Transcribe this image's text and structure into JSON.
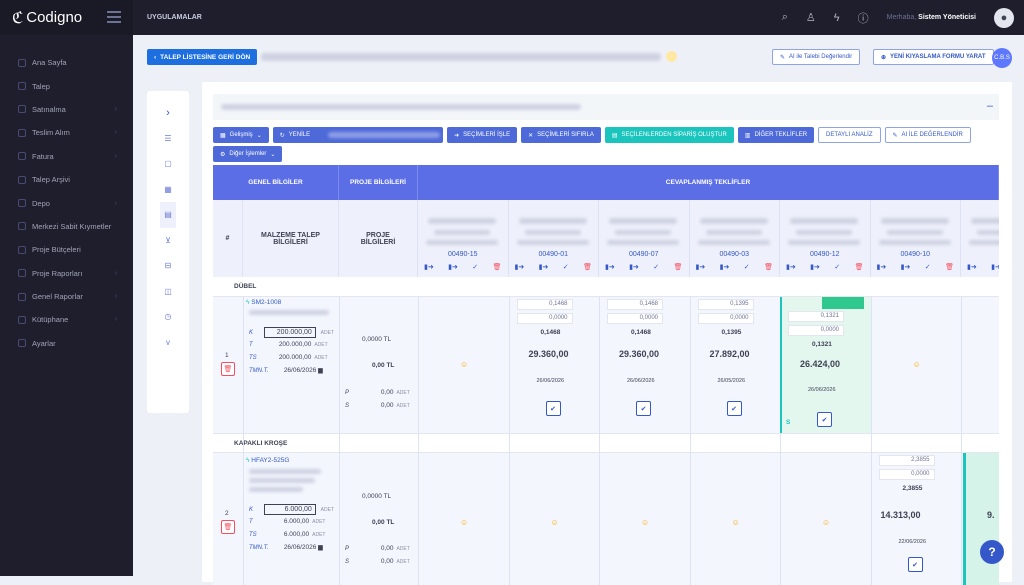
{
  "app": {
    "logo": "Codigno",
    "apps_label": "UYGULAMALAR"
  },
  "user": {
    "greeting": "Merhaba,",
    "name": "Sistem Yöneticisi"
  },
  "sidebar": {
    "items": [
      {
        "label": "Ana Sayfa",
        "arrow": false
      },
      {
        "label": "Talep",
        "arrow": false
      },
      {
        "label": "Satınalma",
        "arrow": true
      },
      {
        "label": "Teslim Alım",
        "arrow": true
      },
      {
        "label": "Fatura",
        "arrow": true
      },
      {
        "label": "Talep Arşivi",
        "arrow": false
      },
      {
        "label": "Depo",
        "arrow": true
      },
      {
        "label": "Merkezi Sabit Kıymetler",
        "arrow": false
      },
      {
        "label": "Proje Bütçeleri",
        "arrow": false
      },
      {
        "label": "Proje Raporları",
        "arrow": true
      },
      {
        "label": "Genel Raporlar",
        "arrow": true
      },
      {
        "label": "Kütüphane",
        "arrow": true
      },
      {
        "label": "Ayarlar",
        "arrow": false
      }
    ]
  },
  "header": {
    "back_label": "TALEP LİSTESİNE GERİ DÖN",
    "ai_button": "AI ile Talebi Değerlendir",
    "new_form_button": "YENİ KIYASLAMA FORMU YARAT",
    "avatar_text": "C.B.S"
  },
  "toolbar": {
    "advanced": "Gelişmiş",
    "refresh": "YENİLE",
    "process": "SEÇİMLERİ İŞLE",
    "reset": "SEÇİMLERİ SIFIRLA",
    "create_order": "SEÇİLENLERDEN SİPARİŞ OLUŞTUR",
    "other_offers": "DİĞER TEKLİFLER",
    "detail": "DETAYLI ANALİZ",
    "ai_eval": "AI İLE DEĞERLENDİR",
    "other_ops": "Diğer İşlemler"
  },
  "grid": {
    "headers": {
      "general": "GENEL BİLGİLER",
      "project": "PROJE BİLGİLERİ",
      "offers": "CEVAPLANMIŞ TEKLİFLER"
    },
    "sub": {
      "hash": "#",
      "material": "MALZEME TALEP BİLGİLERİ",
      "project": "PROJE BİLGİLERİ"
    },
    "offer_codes": [
      "00490-15",
      "00490-01",
      "00490-07",
      "00490-03",
      "00490-12",
      "00490-10",
      "0"
    ],
    "groups": [
      "DÜBEL",
      "KAPAKLI KROŞE"
    ],
    "rows": [
      {
        "no": "1",
        "code": "SM2-1008",
        "k": "200.000,00",
        "t": "200.000,00",
        "ts": "200.000,00",
        "tmn": "26/06/2026",
        "proj_total": "0,0000 TL",
        "proj_val": "0,00 TL",
        "p": "0,00",
        "s": "0,00"
      },
      {
        "no": "2",
        "code": "HFAY2-525G",
        "k": "6.000,00",
        "t": "6.000,00",
        "ts": "6.000,00",
        "tmn": "26/06/2026",
        "proj_total": "0,0000 TL",
        "proj_val": "0,00 TL",
        "p": "0,00",
        "s": "0,00"
      }
    ],
    "labels": {
      "k": "K",
      "t": "T",
      "ts": "TS",
      "tmn": "TMN.T.",
      "p": "P",
      "s": "S",
      "unit": "ADET"
    },
    "row1_offers": [
      {
        "a": "0,1468",
        "b": "0,0000",
        "c": "0,1468",
        "total": "29.360,00",
        "date": "26/06/2026"
      },
      {
        "a": "0,1468",
        "b": "0,0000",
        "c": "0,1468",
        "total": "29.360,00",
        "date": "26/06/2026"
      },
      {
        "a": "0,1395",
        "b": "0,0000",
        "c": "0,1395",
        "total": "27.892,00",
        "date": "26/05/2026"
      },
      {
        "a": "0,1321",
        "b": "0,0000",
        "c": "0,1321",
        "total": "26.424,00",
        "date": "26/06/2026"
      }
    ],
    "row2_offer": {
      "a": "2,3855",
      "b": "0,0000",
      "c": "2,3855",
      "total": "14.313,00",
      "date": "22/06/2026"
    },
    "row2_partial": "9.",
    "s_letter": "S"
  },
  "help": "?"
}
